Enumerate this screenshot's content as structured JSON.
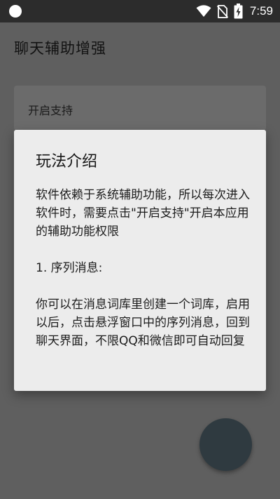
{
  "status_bar": {
    "time": "7:59",
    "icons": [
      "notification-dot-icon",
      "wifi-icon",
      "no-sim-icon",
      "battery-charging-icon"
    ]
  },
  "app": {
    "title": "聊天辅助增强"
  },
  "card": {
    "label": "开启支持"
  },
  "dialog": {
    "title": "玩法介绍",
    "paragraphs": [
      "软件依赖于系统辅助功能，所以每次进入软件时，需要点击\"开启支持\"开启本应用的辅助功能权限",
      "1. 序列消息:",
      "你可以在消息词库里创建一个词库，启用以后，点击悬浮窗口中的序列消息，回到聊天界面，不限QQ和微信即可自动回复"
    ]
  },
  "colors": {
    "status_bar": "#2c2c2c",
    "scrim_background": "#5f5f5f",
    "dialog_background": "#ececec",
    "fab": "#2f3a40"
  }
}
